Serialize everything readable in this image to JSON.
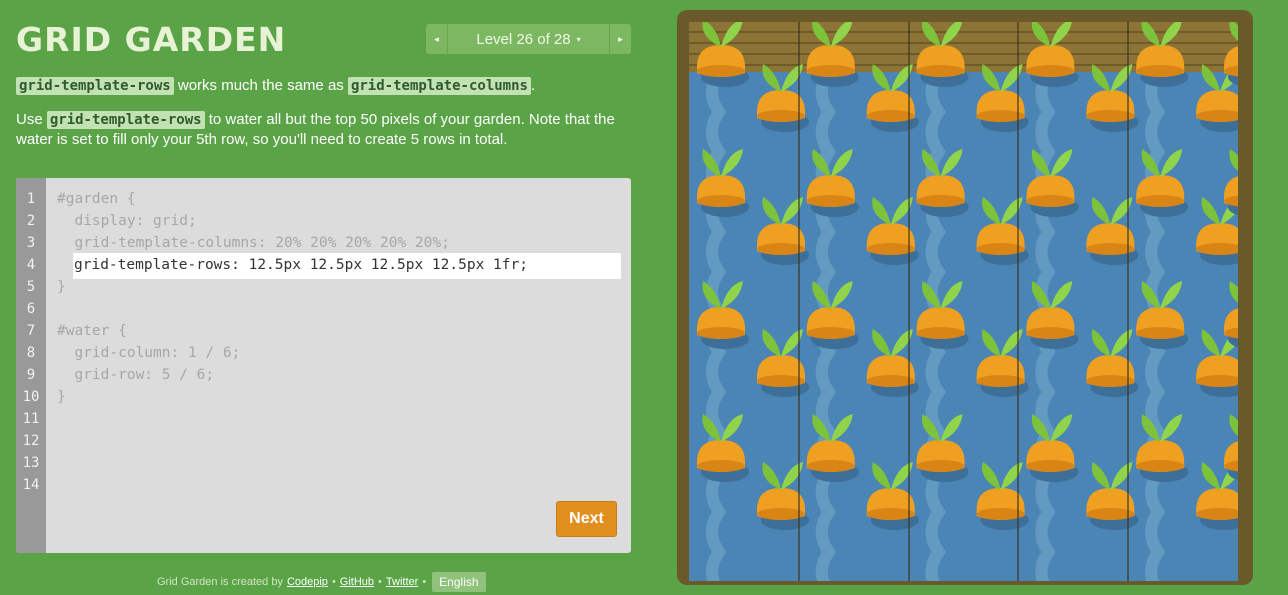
{
  "app": {
    "title": "GRID GARDEN"
  },
  "level_nav": {
    "prev_label": "◂",
    "next_label": "▸",
    "current": "Level 26 of 28",
    "caret": "▾"
  },
  "instructions": {
    "p1": {
      "code1": "grid-template-rows",
      "text1": " works much the same as ",
      "code2": "grid-template-columns",
      "text2": "."
    },
    "p2": {
      "text1": "Use ",
      "code1": "grid-template-rows",
      "text2": " to water all but the top 50 pixels of your garden. Note that the water is set to fill only your 5th row, so you'll need to create 5 rows in total."
    }
  },
  "editor": {
    "line_numbers": [
      "1",
      "2",
      "3",
      "4",
      "5",
      "6",
      "7",
      "8",
      "9",
      "10",
      "11",
      "12",
      "13",
      "14"
    ],
    "lines": {
      "l1": "#garden {",
      "l2": "  display: grid;",
      "l3": "  grid-template-columns: 20% 20% 20% 20% 20%;",
      "l5": "}",
      "l7": "#water {",
      "l8": "  grid-column: 1 / 6;",
      "l9": "  grid-row: 5 / 6;",
      "l10": "}"
    },
    "input_value": "grid-template-rows: 12.5px 12.5px 12.5px 12.5px 1fr;",
    "next_button": "Next"
  },
  "footer": {
    "text": "Grid Garden is created by",
    "codepip": "Codepip",
    "github": "GitHub",
    "twitter": "Twitter",
    "bullet": "•",
    "language": "English"
  },
  "garden": {
    "icons": [
      "carrot-icon",
      "water-icon",
      "wooden-plank-icon"
    ]
  },
  "colors": {
    "background": "#5aa346",
    "water": "#4a85b5",
    "carrot": "#f0a020",
    "sprout": "#7cc23a",
    "soil_frame": "#6b5a29",
    "next_button": "#e1901f"
  }
}
